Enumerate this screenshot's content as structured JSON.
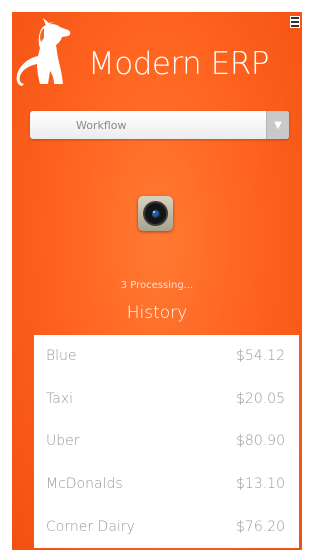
{
  "app": {
    "title": "Modern ERP"
  },
  "workflow_select": {
    "selected": "Workflow"
  },
  "status": {
    "processing_text": "3 Processing..."
  },
  "history": {
    "title": "History",
    "items": [
      {
        "label": "Blue",
        "amount": "$54.12"
      },
      {
        "label": "Taxi",
        "amount": "$20.05"
      },
      {
        "label": "Uber",
        "amount": "$80.90"
      },
      {
        "label": "McDonalds",
        "amount": "$13.10"
      },
      {
        "label": "Corner Dairy",
        "amount": "$76.20"
      }
    ]
  },
  "colors": {
    "accent": "#ff6420",
    "panel": "#ffffff",
    "muted_text": "#9a9a9a"
  },
  "icons": {
    "logo": "dog-logo-icon",
    "menu": "menu-icon",
    "dropdown": "chevron-down-icon",
    "camera": "camera-icon"
  }
}
